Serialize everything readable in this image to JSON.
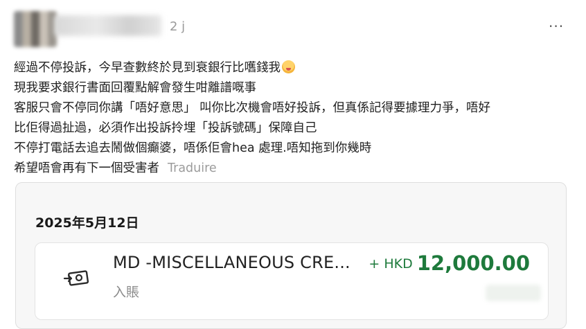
{
  "post": {
    "time": "2 j",
    "more": "···",
    "lines": [
      "經過不停投訴，今早查數終於見到衰銀行比嚿錢我",
      "現我要求銀行書面回覆點解會發生咁離譜嘅事",
      "客服只會不停同你講「唔好意思」 叫你比次機會唔好投訴，但真係記得要據理力爭，唔好",
      "比佢得過扯過，必須作出投訴拎埋「投訴號碼」保障自己",
      "不停打電話去追去鬧做個癲婆，唔係佢會hea 處理.唔知拖到你幾時",
      "希望唔會再有下一個受害者"
    ],
    "translate_label": "Traduire",
    "emoji_icon": "face-emoji-icon"
  },
  "card": {
    "date": "2025年5月12日",
    "transaction": {
      "title": "MD -MISCELLANEOUS CRE...",
      "subtitle": "入賬",
      "amount_prefix": "+ HKD",
      "amount": "12,000.00",
      "icon": "money-transfer-icon",
      "amount_color": "#1e7a3c"
    }
  }
}
